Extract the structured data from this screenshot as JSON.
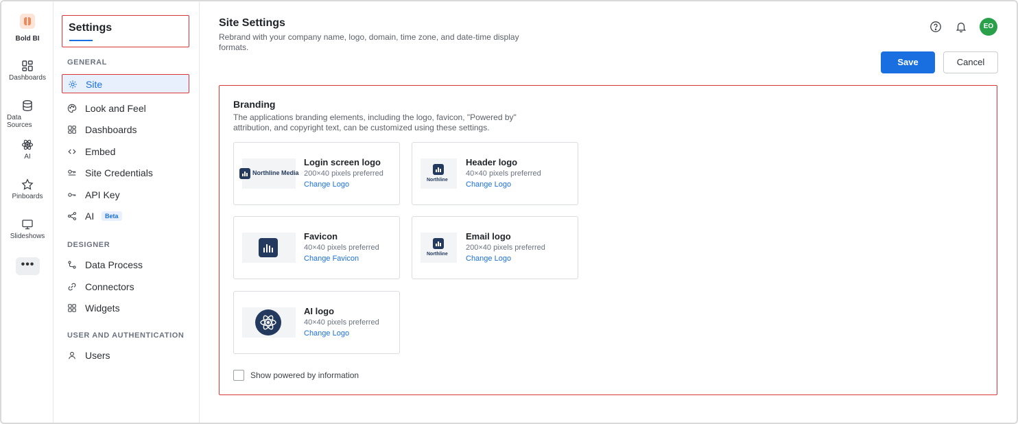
{
  "rail": {
    "brand": "Bold BI",
    "items": [
      {
        "label": "Dashboards",
        "icon": "dashboards-icon"
      },
      {
        "label": "Data Sources",
        "icon": "database-icon"
      },
      {
        "label": "AI",
        "icon": "atom-icon"
      },
      {
        "label": "Pinboards",
        "icon": "star-icon"
      },
      {
        "label": "Slideshows",
        "icon": "monitor-icon"
      }
    ],
    "more": "•••"
  },
  "settings_nav": {
    "title": "Settings",
    "sections": [
      {
        "label": "GENERAL"
      },
      {
        "label": "DESIGNER"
      },
      {
        "label": "USER AND AUTHENTICATION"
      }
    ],
    "items": [
      {
        "label": "Site",
        "icon": "gear-icon",
        "active": true
      },
      {
        "label": "Look and Feel",
        "icon": "palette-icon"
      },
      {
        "label": "Dashboards",
        "icon": "dashboards-icon"
      },
      {
        "label": "Embed",
        "icon": "code-icon"
      },
      {
        "label": "Site Credentials",
        "icon": "credentials-icon"
      },
      {
        "label": "API Key",
        "icon": "key-icon"
      },
      {
        "label": "AI",
        "icon": "share-nodes-icon",
        "badge": "Beta"
      },
      {
        "label": "Data Process",
        "icon": "data-process-icon"
      },
      {
        "label": "Connectors",
        "icon": "link-icon"
      },
      {
        "label": "Widgets",
        "icon": "widgets-icon"
      },
      {
        "label": "Users",
        "icon": "user-icon"
      }
    ]
  },
  "header": {
    "title": "Site Settings",
    "subtitle": "Rebrand with your company name, logo, domain, time zone, and date-time display formats.",
    "avatar_initials": "EO",
    "avatar_color": "#2aa04a",
    "save_label": "Save",
    "cancel_label": "Cancel"
  },
  "branding": {
    "title": "Branding",
    "description": "The applications branding elements, including the logo, favicon, \"Powered by\" attribution, and copyright text, can be customized using these settings.",
    "cards": [
      {
        "name": "Login screen logo",
        "hint": "200×40 pixels preferred",
        "link": "Change Logo",
        "thumb_text": "Northline Media"
      },
      {
        "name": "Header logo",
        "hint": "40×40 pixels preferred",
        "link": "Change Logo",
        "thumb_text": "Northline"
      },
      {
        "name": "Favicon",
        "hint": "40×40 pixels preferred",
        "link": "Change Favicon",
        "thumb_text": ""
      },
      {
        "name": "Email logo",
        "hint": "200×40 pixels preferred",
        "link": "Change Logo",
        "thumb_text": "Northline"
      },
      {
        "name": "AI logo",
        "hint": "40×40 pixels preferred",
        "link": "Change Logo",
        "thumb_text": ""
      }
    ],
    "powered_by_label": "Show powered by information",
    "powered_by_checked": false
  },
  "colors": {
    "accent": "#1a6fe0",
    "highlight_border": "#d93636",
    "logo_navy": "#233a5e"
  }
}
